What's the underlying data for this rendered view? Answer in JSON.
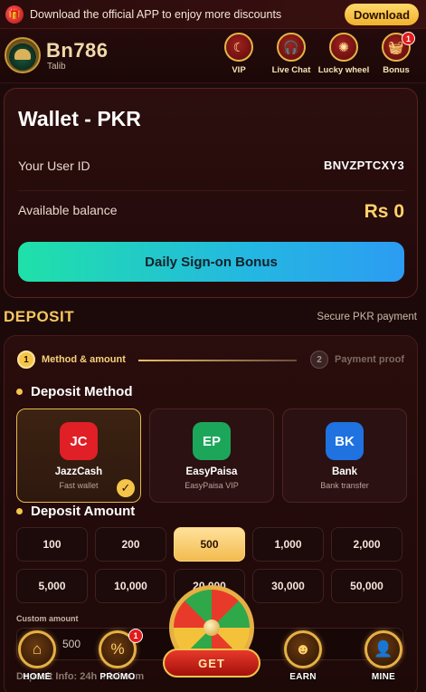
{
  "banner": {
    "text": "Download the official APP to enjoy more discounts",
    "download_label": "Download",
    "gift_icon": "🎁"
  },
  "header": {
    "brand": "Bn786",
    "username": "Talib",
    "nav": [
      {
        "label": "VIP",
        "icon": "☾"
      },
      {
        "label": "Live Chat",
        "icon": "🎧"
      },
      {
        "label": "Lucky wheel",
        "icon": "✺"
      },
      {
        "label": "Bonus",
        "icon": "🧺",
        "badge": "1"
      }
    ]
  },
  "wallet": {
    "title": "Wallet - PKR",
    "user_id_label": "Your User ID",
    "user_id": "BNVZPTCXY3",
    "balance_label": "Available balance",
    "balance": "Rs 0",
    "signon_label": "Daily Sign-on Bonus"
  },
  "deposit": {
    "title": "DEPOSIT",
    "secure_text": "Secure PKR payment",
    "steps": [
      {
        "num": "1",
        "label": "Method & amount",
        "active": true
      },
      {
        "num": "2",
        "label": "Payment proof",
        "active": false
      }
    ],
    "method_heading": "Deposit Method",
    "methods": [
      {
        "code": "JC",
        "name": "JazzCash",
        "sub": "Fast wallet",
        "color": "#e01f26",
        "selected": true
      },
      {
        "code": "EP",
        "name": "EasyPaisa",
        "sub": "EasyPaisa VIP",
        "color": "#1ca65a",
        "selected": false
      },
      {
        "code": "BK",
        "name": "Bank",
        "sub": "Bank transfer",
        "color": "#1f72e0",
        "selected": false
      }
    ],
    "check_icon": "✓",
    "amount_heading": "Deposit Amount",
    "amounts": [
      "100",
      "200",
      "500",
      "1,000",
      "2,000",
      "5,000",
      "10,000",
      "20,000",
      "30,000",
      "50,000"
    ],
    "selected_amount": "500",
    "custom_label": "Custom amount",
    "custom_value": "500",
    "info_text": "Deposit Info: 24h minimum"
  },
  "bottom_nav": {
    "home": {
      "label": "HOME",
      "icon": "⌂"
    },
    "promo": {
      "label": "PROMO",
      "icon": "%",
      "badge": "1"
    },
    "get": {
      "label": "GET"
    },
    "earn": {
      "label": "EARN",
      "icon": "☻"
    },
    "mine": {
      "label": "MINE",
      "icon": "👤"
    }
  },
  "colors": {
    "background": "#1c0a0a",
    "accent_gold": "#f5c54a",
    "balance": "#ffd26a"
  }
}
